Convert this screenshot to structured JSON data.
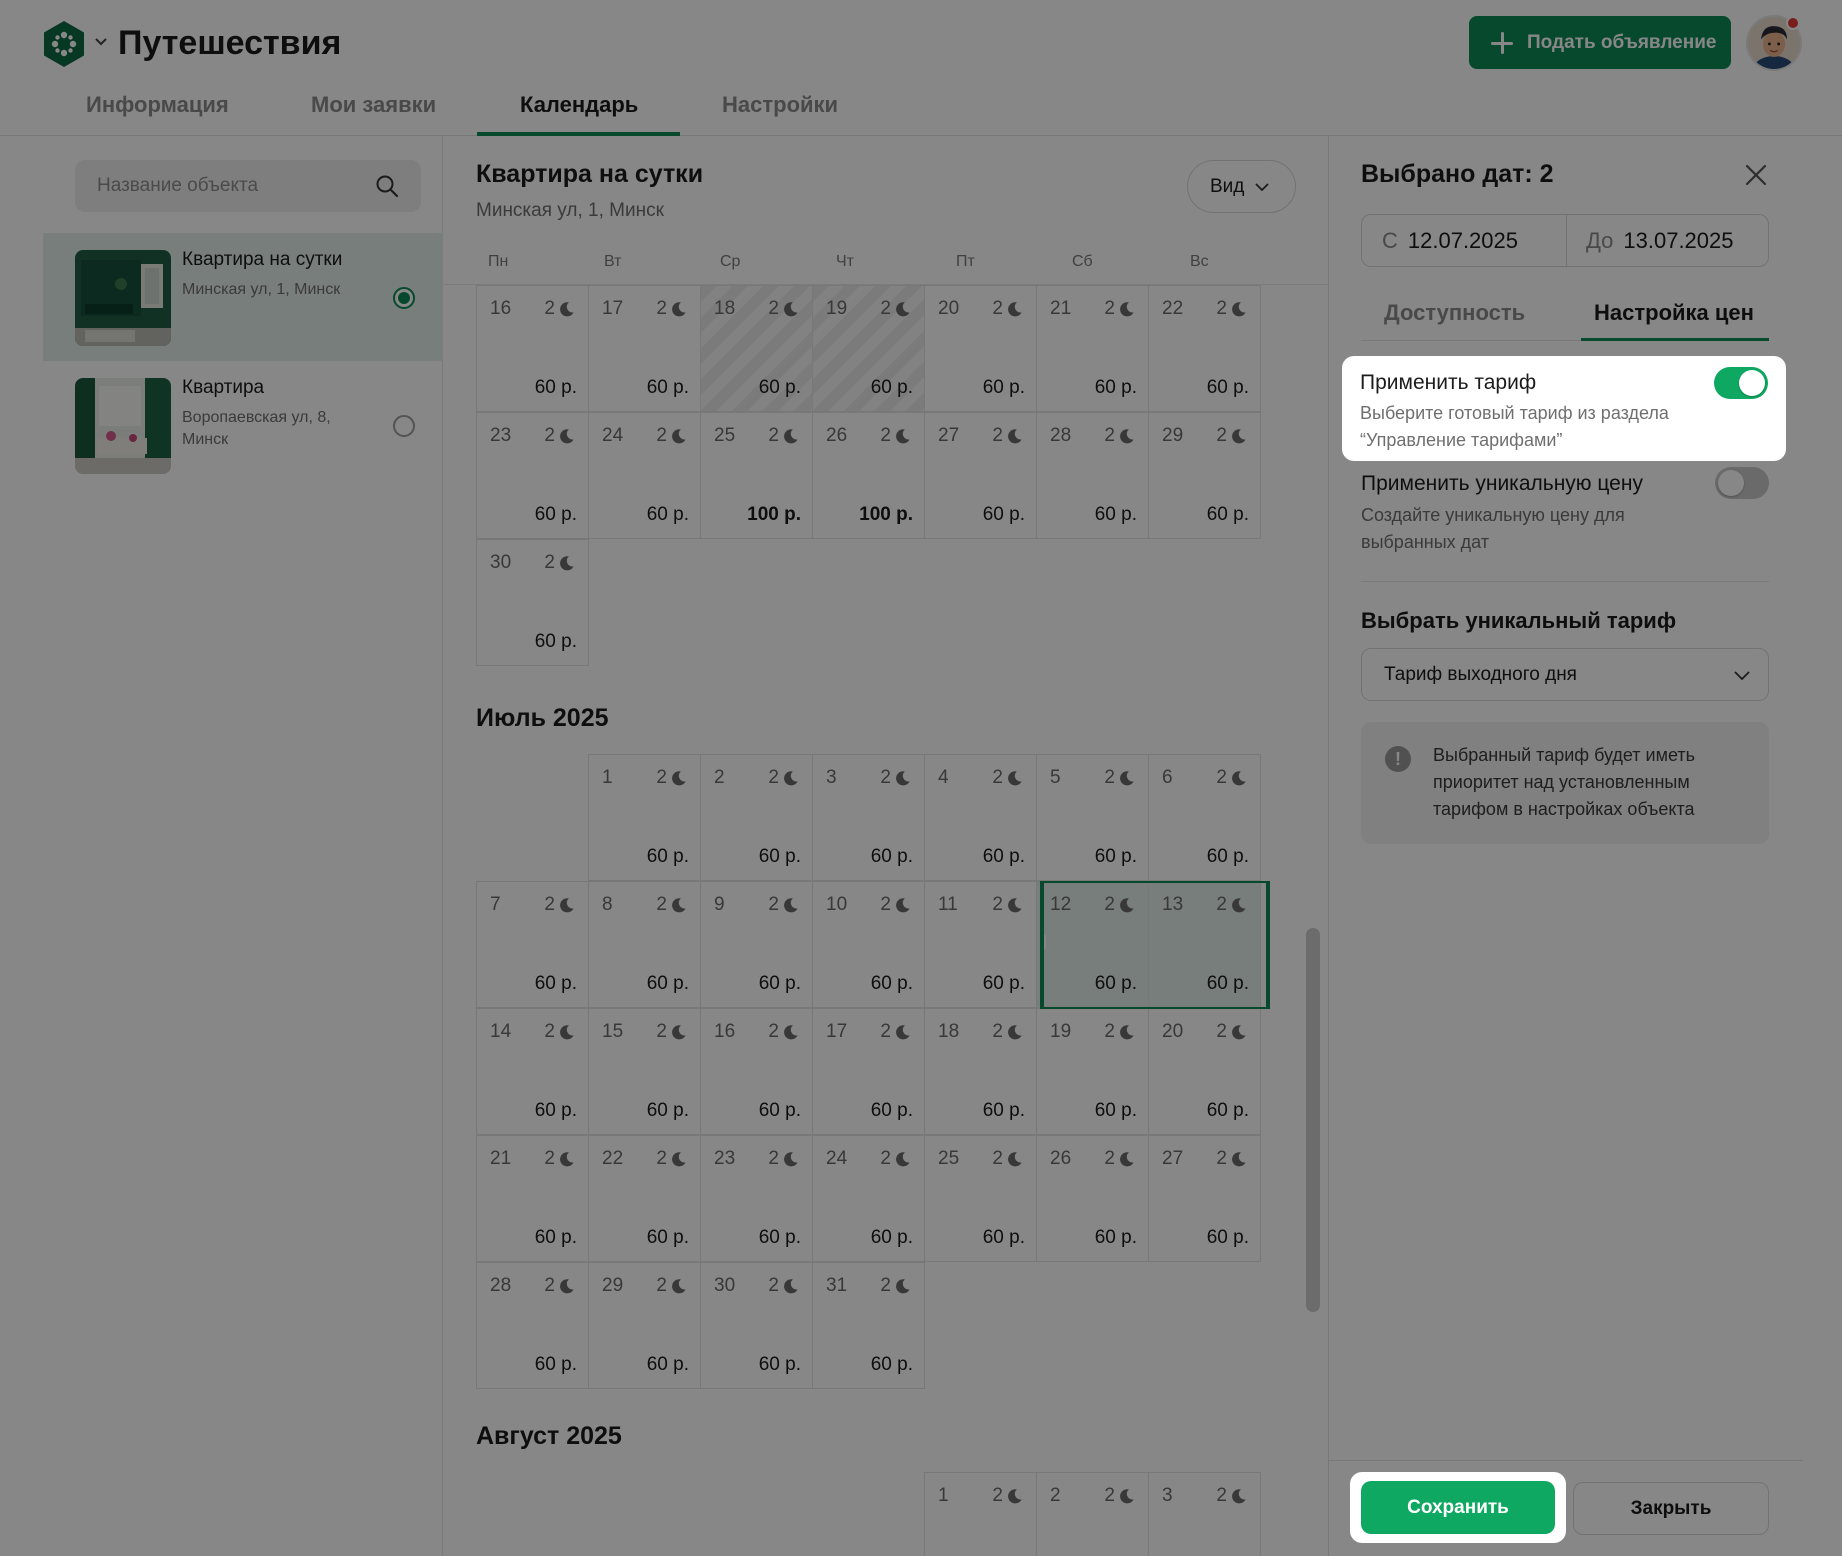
{
  "header": {
    "app_title": "Путешествия",
    "add_button_label": "Подать объявление",
    "nav_tabs": [
      {
        "label": "Информация"
      },
      {
        "label": "Мои заявки"
      },
      {
        "label": "Календарь"
      },
      {
        "label": "Настройки"
      }
    ],
    "active_tab": "Календарь"
  },
  "sidebar": {
    "search_placeholder": "Название объекта",
    "properties": [
      {
        "name": "Квартира на сутки",
        "address": "Минская ул, 1, Минск",
        "selected": true
      },
      {
        "name": "Квартира",
        "address": "Воропаевская ул, 8, Минск",
        "selected": false
      }
    ]
  },
  "calendar": {
    "title": "Квартира на сутки",
    "subtitle": "Минская ул, 1, Минск",
    "view_button": "Вид",
    "weekdays": [
      "Пн",
      "Вт",
      "Ср",
      "Чт",
      "Пт",
      "Сб",
      "Вс"
    ],
    "june_rows": [
      [
        {
          "d": "16",
          "n": "2",
          "p": "60 р."
        },
        {
          "d": "17",
          "n": "2",
          "p": "60 р."
        },
        {
          "d": "18",
          "n": "2",
          "p": "60 р.",
          "blocked": true
        },
        {
          "d": "19",
          "n": "2",
          "p": "60 р.",
          "blocked": true
        },
        {
          "d": "20",
          "n": "2",
          "p": "60 р."
        },
        {
          "d": "21",
          "n": "2",
          "p": "60 р."
        },
        {
          "d": "22",
          "n": "2",
          "p": "60 р."
        }
      ],
      [
        {
          "d": "23",
          "n": "2",
          "p": "60 р."
        },
        {
          "d": "24",
          "n": "2",
          "p": "60 р."
        },
        {
          "d": "25",
          "n": "2",
          "p": "100 р.",
          "bold": true
        },
        {
          "d": "26",
          "n": "2",
          "p": "100 р.",
          "bold": true
        },
        {
          "d": "27",
          "n": "2",
          "p": "60 р."
        },
        {
          "d": "28",
          "n": "2",
          "p": "60 р."
        },
        {
          "d": "29",
          "n": "2",
          "p": "60 р."
        }
      ],
      [
        {
          "d": "30",
          "n": "2",
          "p": "60 р."
        }
      ]
    ],
    "july_title": "Июль 2025",
    "july_rows": [
      [
        null,
        {
          "d": "1",
          "n": "2",
          "p": "60 р."
        },
        {
          "d": "2",
          "n": "2",
          "p": "60 р."
        },
        {
          "d": "3",
          "n": "2",
          "p": "60 р."
        },
        {
          "d": "4",
          "n": "2",
          "p": "60 р."
        },
        {
          "d": "5",
          "n": "2",
          "p": "60 р."
        },
        {
          "d": "6",
          "n": "2",
          "p": "60 р."
        }
      ],
      [
        {
          "d": "7",
          "n": "2",
          "p": "60 р."
        },
        {
          "d": "8",
          "n": "2",
          "p": "60 р."
        },
        {
          "d": "9",
          "n": "2",
          "p": "60 р."
        },
        {
          "d": "10",
          "n": "2",
          "p": "60 р."
        },
        {
          "d": "11",
          "n": "2",
          "p": "60 р."
        },
        {
          "d": "12",
          "n": "2",
          "p": "60 р.",
          "selected": true
        },
        {
          "d": "13",
          "n": "2",
          "p": "60 р.",
          "selected": true
        }
      ],
      [
        {
          "d": "14",
          "n": "2",
          "p": "60 р."
        },
        {
          "d": "15",
          "n": "2",
          "p": "60 р."
        },
        {
          "d": "16",
          "n": "2",
          "p": "60 р."
        },
        {
          "d": "17",
          "n": "2",
          "p": "60 р."
        },
        {
          "d": "18",
          "n": "2",
          "p": "60 р."
        },
        {
          "d": "19",
          "n": "2",
          "p": "60 р."
        },
        {
          "d": "20",
          "n": "2",
          "p": "60 р."
        }
      ],
      [
        {
          "d": "21",
          "n": "2",
          "p": "60 р."
        },
        {
          "d": "22",
          "n": "2",
          "p": "60 р."
        },
        {
          "d": "23",
          "n": "2",
          "p": "60 р."
        },
        {
          "d": "24",
          "n": "2",
          "p": "60 р."
        },
        {
          "d": "25",
          "n": "2",
          "p": "60 р."
        },
        {
          "d": "26",
          "n": "2",
          "p": "60 р."
        },
        {
          "d": "27",
          "n": "2",
          "p": "60 р."
        }
      ],
      [
        {
          "d": "28",
          "n": "2",
          "p": "60 р."
        },
        {
          "d": "29",
          "n": "2",
          "p": "60 р."
        },
        {
          "d": "30",
          "n": "2",
          "p": "60 р."
        },
        {
          "d": "31",
          "n": "2",
          "p": "60 р."
        }
      ]
    ],
    "august_title": "Август 2025",
    "august_rows": [
      [
        null,
        null,
        null,
        null,
        {
          "d": "1",
          "n": "2",
          "p": ""
        },
        {
          "d": "2",
          "n": "2",
          "p": ""
        },
        {
          "d": "3",
          "n": "2",
          "p": ""
        }
      ]
    ]
  },
  "panel": {
    "title": "Выбрано дат: 2",
    "from_prefix": "С",
    "from_date": "12.07.2025",
    "to_prefix": "До",
    "to_date": "13.07.2025",
    "tabs": [
      {
        "label": "Доступность"
      },
      {
        "label": "Настройка цен"
      }
    ],
    "apply_tariff_title": "Применить тариф",
    "apply_tariff_desc": "Выберите готовый тариф из раздела “Управление тарифами”",
    "apply_tariff_on": true,
    "unique_price_title": "Применить уникальную цену",
    "unique_price_desc": "Создайте уникальную цену для выбранных дат",
    "unique_price_on": false,
    "unique_tariff_title": "Выбрать уникальный тариф",
    "tariff_select_value": "Тариф выходного дня",
    "info_text": "Выбранный тариф будет иметь приоритет над установленным тарифом в настройках объекта",
    "save_label": "Сохранить",
    "close_label": "Закрыть"
  },
  "colors": {
    "accent": "#0c8a55",
    "toggle_on": "#0fa862",
    "overlay": "rgba(0,0,0,0.47)"
  }
}
